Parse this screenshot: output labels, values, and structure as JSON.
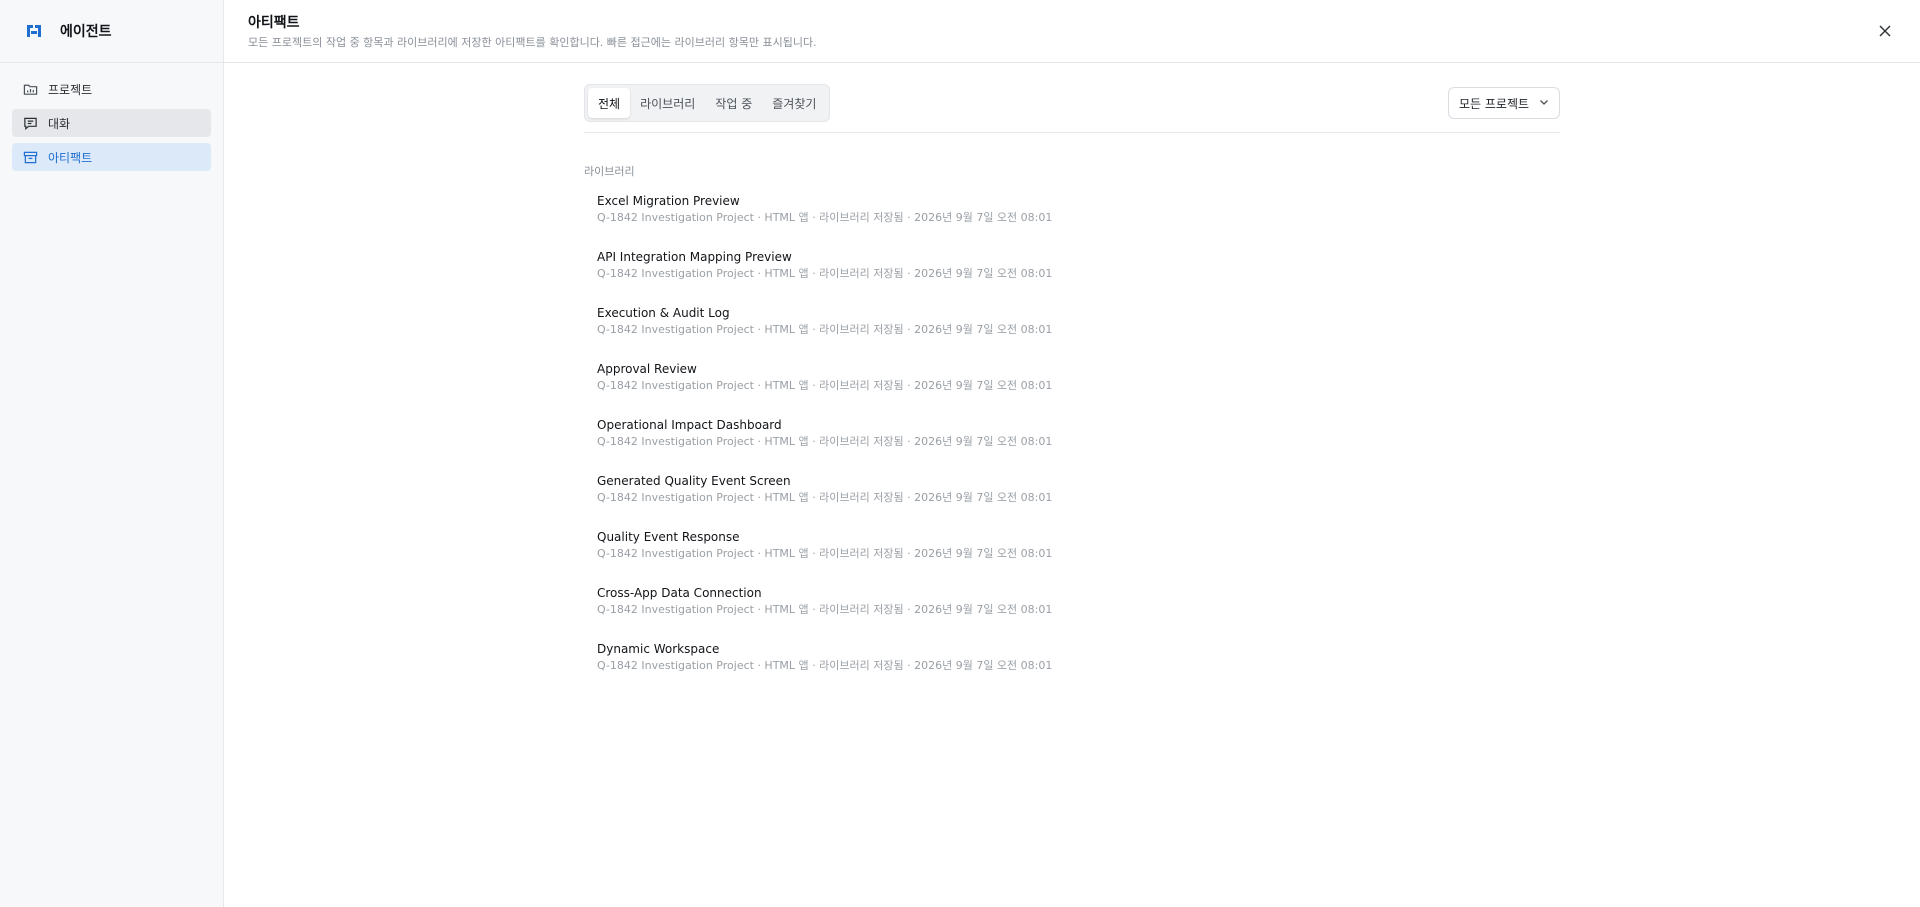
{
  "app": {
    "name": "에이전트"
  },
  "sidebar": {
    "items": [
      {
        "label": "프로젝트",
        "icon": "folder-chart-icon"
      },
      {
        "label": "대화",
        "icon": "message-square-icon"
      },
      {
        "label": "아티팩트",
        "icon": "archive-icon"
      }
    ]
  },
  "header": {
    "title": "아티팩트",
    "subtitle": "모든 프로젝트의 작업 중 항목과 라이브러리에 저장한 아티팩트를 확인합니다. 빠른 접근에는 라이브러리 항목만 표시됩니다."
  },
  "tabs": [
    {
      "label": "전체",
      "selected": true
    },
    {
      "label": "라이브러리",
      "selected": false
    },
    {
      "label": "작업 중",
      "selected": false
    },
    {
      "label": "즐겨찾기",
      "selected": false
    }
  ],
  "filter": {
    "selected": "모든 프로젝트"
  },
  "section": {
    "label": "라이브러리"
  },
  "artifacts": [
    {
      "title": "Excel Migration Preview",
      "meta": "Q-1842 Investigation Project · HTML 앱 · 라이브러리 저장됨 · 2026년 9월 7일 오전 08:01"
    },
    {
      "title": "API Integration Mapping Preview",
      "meta": "Q-1842 Investigation Project · HTML 앱 · 라이브러리 저장됨 · 2026년 9월 7일 오전 08:01"
    },
    {
      "title": "Execution & Audit Log",
      "meta": "Q-1842 Investigation Project · HTML 앱 · 라이브러리 저장됨 · 2026년 9월 7일 오전 08:01"
    },
    {
      "title": "Approval Review",
      "meta": "Q-1842 Investigation Project · HTML 앱 · 라이브러리 저장됨 · 2026년 9월 7일 오전 08:01"
    },
    {
      "title": "Operational Impact Dashboard",
      "meta": "Q-1842 Investigation Project · HTML 앱 · 라이브러리 저장됨 · 2026년 9월 7일 오전 08:01"
    },
    {
      "title": "Generated Quality Event Screen",
      "meta": "Q-1842 Investigation Project · HTML 앱 · 라이브러리 저장됨 · 2026년 9월 7일 오전 08:01"
    },
    {
      "title": "Quality Event Response",
      "meta": "Q-1842 Investigation Project · HTML 앱 · 라이브러리 저장됨 · 2026년 9월 7일 오전 08:01"
    },
    {
      "title": "Cross-App Data Connection",
      "meta": "Q-1842 Investigation Project · HTML 앱 · 라이브러리 저장됨 · 2026년 9월 7일 오전 08:01"
    },
    {
      "title": "Dynamic Workspace",
      "meta": "Q-1842 Investigation Project · HTML 앱 · 라이브러리 저장됨 · 2026년 9월 7일 오전 08:01"
    }
  ],
  "colors": {
    "accent": "#1f6fd1",
    "active_bg": "#dce9f9",
    "logo": "#1f6fd1"
  }
}
